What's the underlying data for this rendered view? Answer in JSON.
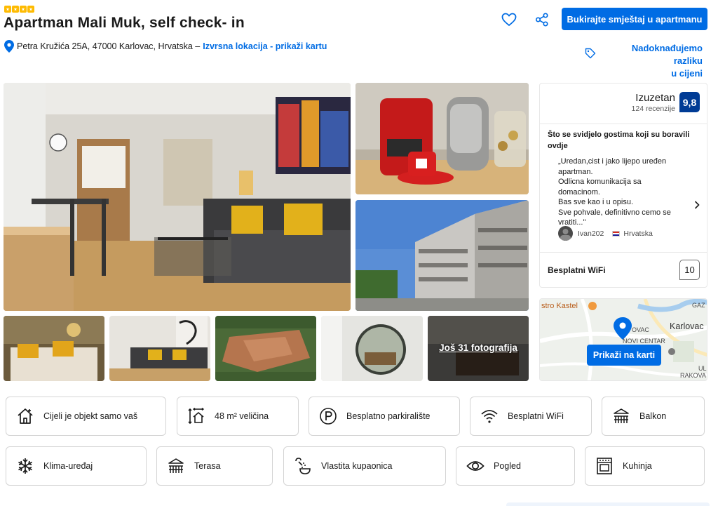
{
  "rating_stars": 4,
  "colors": {
    "accent": "#006ce4",
    "score_bg": "#003b95",
    "star": "#febb02"
  },
  "property": {
    "title": "Apartman Mali Muk, self check- in",
    "address": "Petra Kružića 25A, 47000 Karlovac, Hrvatska –",
    "location_link": "Izvrsna lokacija - prikaži kartu"
  },
  "header_actions": {
    "save_icon": "heart-icon",
    "share_icon": "share-icon",
    "book_label": "Bukirajte smještaj u apartmanu",
    "price_match_line1": "Nadoknađujemo razliku",
    "price_match_line2": "u cijeni"
  },
  "gallery": {
    "more_photos_label": "Još 31 fotografija"
  },
  "review_summary": {
    "label": "Izuzetan",
    "count": "124 recenzije",
    "score": "9,8",
    "heading": "Što se svidjelo gostima koji su boravili ovdje",
    "quote_lines": [
      "„Uredan,cist i jako lijepo uređen",
      "apartman.",
      "Odlicna komunikacija sa",
      "domacinom.",
      "Bas sve kao i u opisu.",
      "Sve pohvale, definitivno cemo se",
      "vratiti...\""
    ],
    "reviewer_name": "Ivan202",
    "reviewer_country": "Hrvatska",
    "wifi_label": "Besplatni WiFi",
    "wifi_score": "10"
  },
  "map": {
    "labels": {
      "kastel": "stro Kastel",
      "gaz": "GAZ",
      "karlovac": "Karlovac",
      "novi_centar": "NOVI CENTAR",
      "rakova": "RAKOVA",
      "ovac": "OVAC",
      "ul": "UL"
    },
    "button_label": "Prikaži na karti"
  },
  "facilities_row1": [
    {
      "icon": "house-icon",
      "label": "Cijeli je objekt samo vaš"
    },
    {
      "icon": "size-icon",
      "label": "48 m² veličina"
    },
    {
      "icon": "parking-icon",
      "label": "Besplatno parkiralište"
    },
    {
      "icon": "wifi-icon",
      "label": "Besplatni WiFi"
    },
    {
      "icon": "balcony-icon",
      "label": "Balkon"
    }
  ],
  "facilities_row2": [
    {
      "icon": "snowflake-icon",
      "label": "Klima-uređaj"
    },
    {
      "icon": "terrace-icon",
      "label": "Terasa"
    },
    {
      "icon": "bathroom-icon",
      "label": "Vlastita kupaonica"
    },
    {
      "icon": "eye-icon",
      "label": "Pogled"
    },
    {
      "icon": "kitchen-icon",
      "label": "Kuhinja"
    }
  ]
}
